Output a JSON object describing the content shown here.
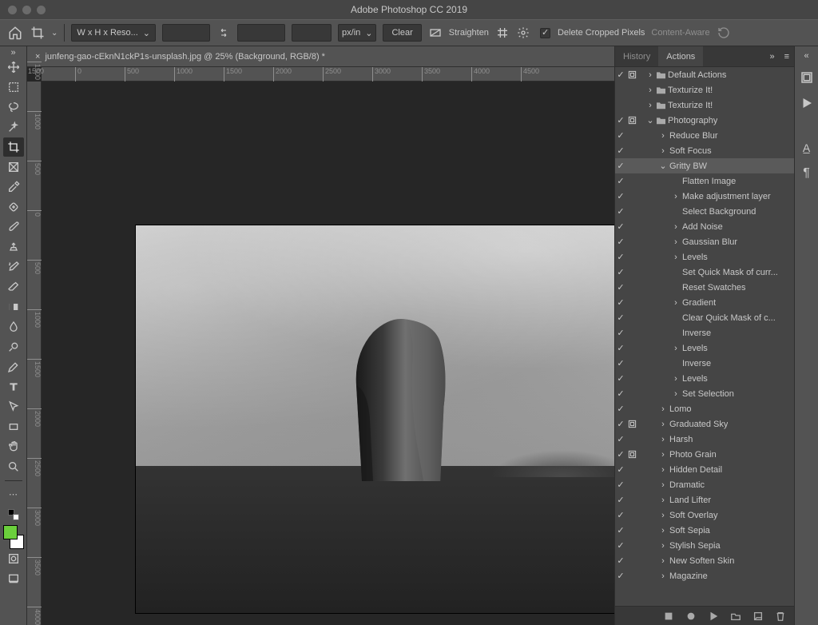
{
  "app_title": "Adobe Photoshop CC 2019",
  "options": {
    "preset": "W x H x Reso...",
    "unit": "px/in",
    "clear": "Clear",
    "straighten": "Straighten",
    "delete_cropped": "Delete Cropped Pixels",
    "content_aware": "Content-Aware"
  },
  "document": {
    "tab_label": "junfeng-gao-cEknN1ckP1s-unsplash.jpg @ 25% (Background, RGB/8) *"
  },
  "ruler": {
    "h": [
      "1500",
      "0",
      "500",
      "1000",
      "1500",
      "2000",
      "2500",
      "3000",
      "3500",
      "4000",
      "4500"
    ],
    "v": [
      "1500",
      "1000",
      "500",
      "0",
      "500",
      "1000",
      "1500",
      "2000",
      "2500",
      "3000",
      "3500",
      "4000"
    ]
  },
  "tabs": {
    "history": "History",
    "actions": "Actions"
  },
  "tree": [
    {
      "d": 0,
      "chk": true,
      "mod": true,
      "disc": ">",
      "folder": true,
      "label": "Default Actions"
    },
    {
      "d": 0,
      "chk": false,
      "mod": false,
      "disc": ">",
      "folder": true,
      "label": "Texturize It!"
    },
    {
      "d": 0,
      "chk": false,
      "mod": false,
      "disc": ">",
      "folder": true,
      "label": "Texturize It!"
    },
    {
      "d": 0,
      "chk": true,
      "mod": true,
      "disc": "v",
      "folder": true,
      "label": "Photography"
    },
    {
      "d": 1,
      "chk": true,
      "mod": false,
      "disc": ">",
      "folder": false,
      "label": "Reduce Blur"
    },
    {
      "d": 1,
      "chk": true,
      "mod": false,
      "disc": ">",
      "folder": false,
      "label": "Soft Focus"
    },
    {
      "d": 1,
      "chk": true,
      "mod": false,
      "disc": "v",
      "folder": false,
      "label": "Gritty BW",
      "sel": true
    },
    {
      "d": 2,
      "chk": true,
      "mod": false,
      "disc": "",
      "folder": false,
      "label": "Flatten Image"
    },
    {
      "d": 2,
      "chk": true,
      "mod": false,
      "disc": ">",
      "folder": false,
      "label": "Make adjustment layer"
    },
    {
      "d": 2,
      "chk": true,
      "mod": false,
      "disc": "",
      "folder": false,
      "label": "Select Background"
    },
    {
      "d": 2,
      "chk": true,
      "mod": false,
      "disc": ">",
      "folder": false,
      "label": "Add Noise"
    },
    {
      "d": 2,
      "chk": true,
      "mod": false,
      "disc": ">",
      "folder": false,
      "label": "Gaussian Blur"
    },
    {
      "d": 2,
      "chk": true,
      "mod": false,
      "disc": ">",
      "folder": false,
      "label": "Levels"
    },
    {
      "d": 2,
      "chk": true,
      "mod": false,
      "disc": "",
      "folder": false,
      "label": "Set Quick Mask of curr..."
    },
    {
      "d": 2,
      "chk": true,
      "mod": false,
      "disc": "",
      "folder": false,
      "label": "Reset Swatches"
    },
    {
      "d": 2,
      "chk": true,
      "mod": false,
      "disc": ">",
      "folder": false,
      "label": "Gradient"
    },
    {
      "d": 2,
      "chk": true,
      "mod": false,
      "disc": "",
      "folder": false,
      "label": "Clear Quick Mask of c..."
    },
    {
      "d": 2,
      "chk": true,
      "mod": false,
      "disc": "",
      "folder": false,
      "label": "Inverse"
    },
    {
      "d": 2,
      "chk": true,
      "mod": false,
      "disc": ">",
      "folder": false,
      "label": "Levels"
    },
    {
      "d": 2,
      "chk": true,
      "mod": false,
      "disc": "",
      "folder": false,
      "label": "Inverse"
    },
    {
      "d": 2,
      "chk": true,
      "mod": false,
      "disc": ">",
      "folder": false,
      "label": "Levels"
    },
    {
      "d": 2,
      "chk": true,
      "mod": false,
      "disc": ">",
      "folder": false,
      "label": "Set Selection"
    },
    {
      "d": 1,
      "chk": true,
      "mod": false,
      "disc": ">",
      "folder": false,
      "label": "Lomo"
    },
    {
      "d": 1,
      "chk": true,
      "mod": true,
      "disc": ">",
      "folder": false,
      "label": "Graduated Sky"
    },
    {
      "d": 1,
      "chk": true,
      "mod": false,
      "disc": ">",
      "folder": false,
      "label": "Harsh"
    },
    {
      "d": 1,
      "chk": true,
      "mod": true,
      "disc": ">",
      "folder": false,
      "label": "Photo Grain"
    },
    {
      "d": 1,
      "chk": true,
      "mod": false,
      "disc": ">",
      "folder": false,
      "label": "Hidden Detail"
    },
    {
      "d": 1,
      "chk": true,
      "mod": false,
      "disc": ">",
      "folder": false,
      "label": "Dramatic"
    },
    {
      "d": 1,
      "chk": true,
      "mod": false,
      "disc": ">",
      "folder": false,
      "label": "Land Lifter"
    },
    {
      "d": 1,
      "chk": true,
      "mod": false,
      "disc": ">",
      "folder": false,
      "label": "Soft Overlay"
    },
    {
      "d": 1,
      "chk": true,
      "mod": false,
      "disc": ">",
      "folder": false,
      "label": "Soft Sepia"
    },
    {
      "d": 1,
      "chk": true,
      "mod": false,
      "disc": ">",
      "folder": false,
      "label": "Stylish Sepia"
    },
    {
      "d": 1,
      "chk": true,
      "mod": false,
      "disc": ">",
      "folder": false,
      "label": "New Soften Skin"
    },
    {
      "d": 1,
      "chk": true,
      "mod": false,
      "disc": ">",
      "folder": false,
      "label": "Magazine"
    }
  ]
}
